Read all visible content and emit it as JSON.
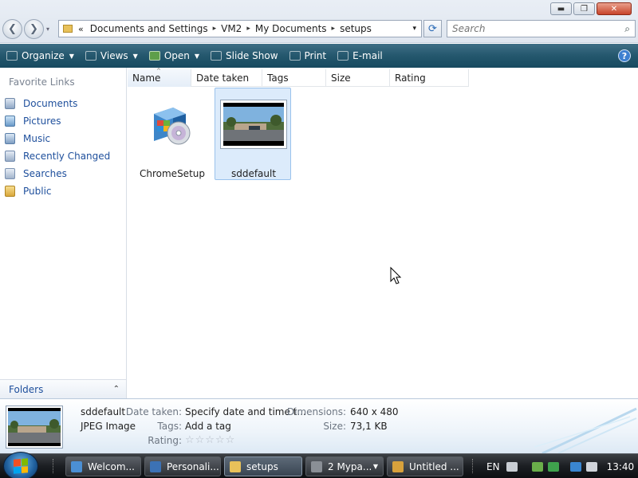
{
  "window": {
    "controls": {
      "minimize": "▬",
      "maximize": "❐",
      "close": "✕"
    }
  },
  "nav": {
    "back": "❮",
    "forward": "❯",
    "history": "▾"
  },
  "address": {
    "overflow": "«",
    "crumbs": [
      "Documents and Settings",
      "VM2",
      "My Documents",
      "setups"
    ],
    "separator": "▸",
    "dropdown": "▾",
    "refresh": "⟳"
  },
  "search": {
    "placeholder": "Search",
    "icon": "⌕"
  },
  "toolbar": {
    "items": [
      {
        "label": "Organize",
        "icon": "organize-icon",
        "dropdown": true
      },
      {
        "label": "Views",
        "icon": "views-icon",
        "dropdown": true
      },
      {
        "label": "Open",
        "icon": "open-icon",
        "dropdown": true
      },
      {
        "label": "Slide Show",
        "icon": "slideshow-icon",
        "dropdown": false
      },
      {
        "label": "Print",
        "icon": "print-icon",
        "dropdown": false
      },
      {
        "label": "E-mail",
        "icon": "email-icon",
        "dropdown": false
      }
    ],
    "arrow": "▼",
    "help": "?"
  },
  "sidebar": {
    "heading": "Favorite Links",
    "items": [
      {
        "label": "Documents",
        "icon": "documents-icon"
      },
      {
        "label": "Pictures",
        "icon": "pictures-icon"
      },
      {
        "label": "Music",
        "icon": "music-icon"
      },
      {
        "label": "Recently Changed",
        "icon": "recently-changed-icon"
      },
      {
        "label": "Searches",
        "icon": "searches-icon"
      },
      {
        "label": "Public",
        "icon": "public-folder-icon"
      }
    ],
    "folders_label": "Folders",
    "folders_toggle": "⌃"
  },
  "columns": [
    "Name",
    "Date taken",
    "Tags",
    "Size",
    "Rating"
  ],
  "sort_indicator": "^",
  "files": [
    {
      "name": "ChromeSetup",
      "icon": "installer-icon",
      "selected": false
    },
    {
      "name": "sddefault",
      "icon": "image-thumbnail",
      "selected": true
    }
  ],
  "details": {
    "name": "sddefault",
    "type": "JPEG Image",
    "date_label": "Date taken:",
    "date_value": "Specify date and time t...",
    "tags_label": "Tags:",
    "tags_value": "Add a tag",
    "rating_label": "Rating:",
    "rating_stars": "☆☆☆☆☆",
    "rating_value": 0,
    "dimensions_label": "Dimensions:",
    "dimensions_value": "640 x 480",
    "size_label": "Size:",
    "size_value": "73,1 KB"
  },
  "taskbar": {
    "buttons": [
      {
        "label": "Welcom...",
        "icon": "welcome-icon",
        "active": false
      },
      {
        "label": "Personali...",
        "icon": "personalize-icon",
        "active": false
      },
      {
        "label": "setups",
        "icon": "folder-icon",
        "active": true
      },
      {
        "label": "2 Mypa...",
        "icon": "paint-icon",
        "active": false,
        "dropdown": true
      },
      {
        "label": "Untitled ...",
        "icon": "paint-brush-icon",
        "active": false
      }
    ],
    "language": "EN",
    "clock": "13:40"
  },
  "colors": {
    "toolbar": "#24576d",
    "link": "#1e4f9c",
    "selection": "#dcebfb"
  }
}
